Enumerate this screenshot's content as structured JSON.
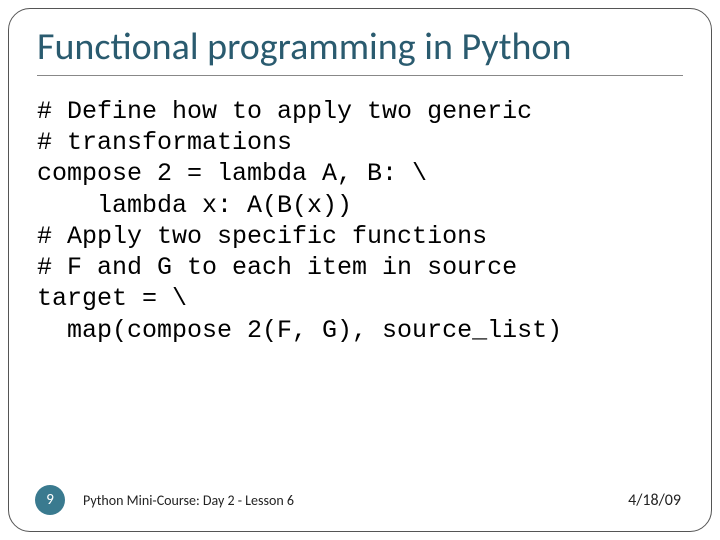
{
  "title": "Functional programming in Python",
  "code": "# Define how to apply two generic\n# transformations\ncompose 2 = lambda A, B: \\\n    lambda x: A(B(x))\n# Apply two specific functions\n# F and G to each item in source\ntarget = \\\n  map(compose 2(F, G), source_list)",
  "footer": {
    "page": "9",
    "course": "Python Mini-Course: Day 2 - Lesson 6",
    "date": "4/18/09"
  }
}
